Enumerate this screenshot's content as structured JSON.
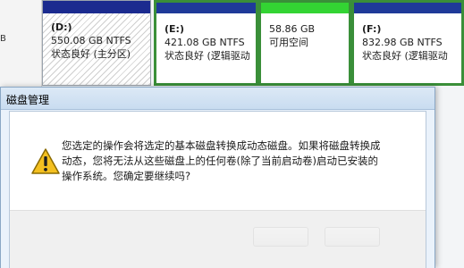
{
  "disk_strip": {
    "gutter_label": "B",
    "partitions": [
      {
        "name": "(D:)",
        "size_fs": "550.08 GB NTFS",
        "status": "状态良好 (主分区)"
      },
      {
        "name": "(E:)",
        "size_fs": "421.08 GB NTFS",
        "status": "状态良好 (逻辑驱动"
      },
      {
        "name": "",
        "size_fs": "58.86 GB",
        "status": "可用空间"
      },
      {
        "name": "(F:)",
        "size_fs": "832.98 GB NTFS",
        "status": "状态良好 (逻辑驱动"
      }
    ]
  },
  "dialog": {
    "title": "磁盘管理",
    "message_line1": "您选定的操作会将选定的基本磁盘转换成动态磁盘。如果将磁盘转换成",
    "message_line2": "动态，您将无法从这些磁盘上的任何卷(除了当前启动卷)启动已安装的",
    "message_line3": "操作系统。您确定要继续吗?",
    "icon": "warning-icon"
  },
  "colors": {
    "primary_partition_bar": "#1b2b8f",
    "logical_partition_bar": "#1f3a99",
    "free_space_bar": "#33d433",
    "selection_border": "#3a8f39"
  }
}
